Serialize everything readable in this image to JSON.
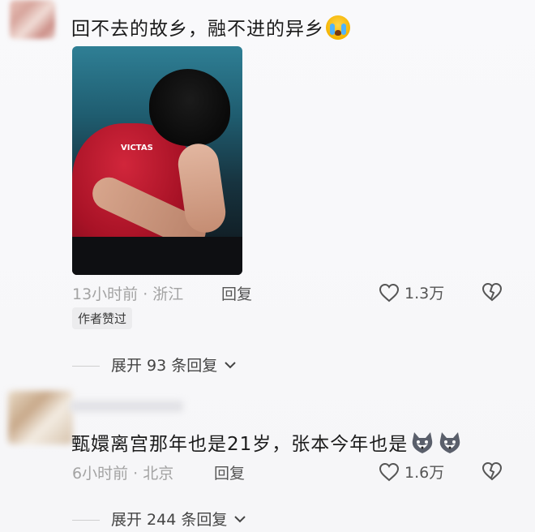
{
  "comments": [
    {
      "text": "回不去的故乡，融不进的异乡",
      "emoji": "crying-face-emoji",
      "time": "13小时前 · 浙江",
      "reply_label": "回复",
      "author_badge": "作者赞过",
      "likes": "1.3万",
      "expand_label": "展开 93 条回复"
    },
    {
      "text": "甄嬛离宫那年也是21岁，张本今年也是",
      "emoji": "husky-emoji",
      "time": "6小时前 · 北京",
      "reply_label": "回复",
      "likes": "1.6万",
      "expand_label": "展开 244 条回复"
    }
  ],
  "photo": {
    "shirt_brand": "VICTAS"
  },
  "icons": {
    "like": "heart-outline-icon",
    "dislike": "broken-heart-icon",
    "expand": "chevron-down-icon"
  },
  "colors": {
    "text": "#1b1b1b",
    "meta": "#9a9a9a",
    "reply": "#555555"
  }
}
